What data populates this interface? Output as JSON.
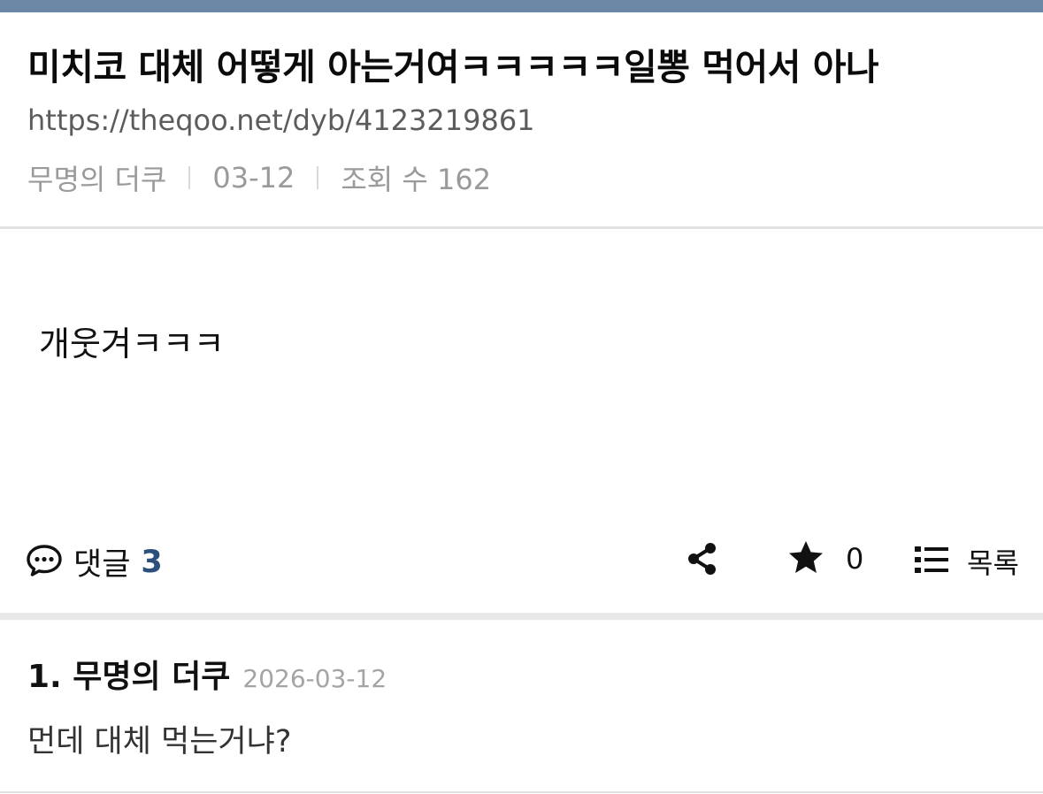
{
  "colors": {
    "topbar": "#6b87a5",
    "comment_count": "#2c4f7c"
  },
  "post": {
    "title": "미치코 대체 어떻게 아는거여ㅋㅋㅋㅋㅋ일뽕 먹어서 아나",
    "url": "https://theqoo.net/dyb/4123219861",
    "author": "무명의 더쿠",
    "date": "03-12",
    "views": "조회 수 162",
    "body": "개웃겨ㅋㅋㅋ"
  },
  "actions": {
    "comment_icon": "speech-bubble-icon",
    "comment_label": "댓글",
    "comment_count": "3",
    "share_icon": "share-icon",
    "star_icon": "star-icon",
    "star_count": "0",
    "list_icon": "list-icon",
    "list_label": "목록"
  },
  "comments": [
    {
      "author": "1. 무명의 더쿠",
      "date": "2026-03-12",
      "text": "먼데 대체 먹는거냐?"
    }
  ]
}
